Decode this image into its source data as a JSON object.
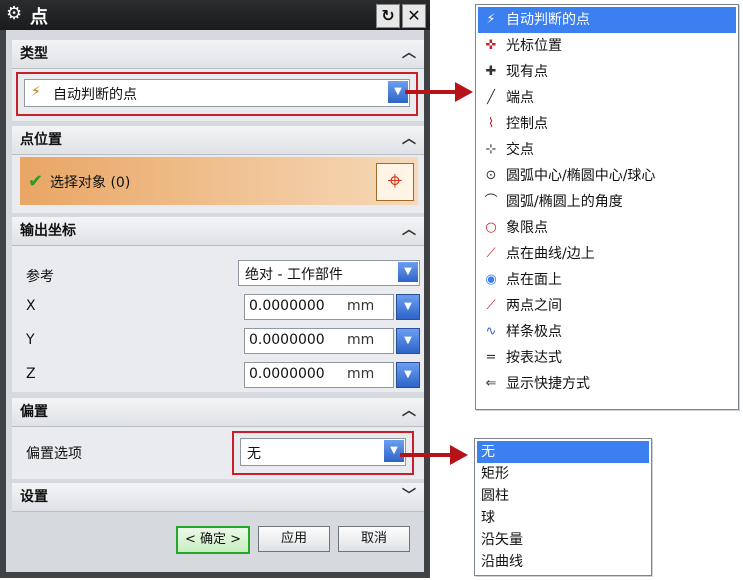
{
  "dialog": {
    "title": "点",
    "icons": {
      "settings": "gear-icon",
      "reset": "reset-icon",
      "close": "close-icon"
    },
    "reset_glyph": "↻",
    "close_glyph": "✕",
    "sections": {
      "type": {
        "label": "类型",
        "value": "自动判断的点"
      },
      "point_location": {
        "label": "点位置",
        "select_label": "选择对象 (0)"
      },
      "output": {
        "label": "输出坐标",
        "reference_label": "参考",
        "reference_value": "绝对 - 工作部件",
        "x_label": "X",
        "x_value": "0.0000000",
        "x_unit": "mm",
        "y_label": "Y",
        "y_value": "0.0000000",
        "y_unit": "mm",
        "z_label": "Z",
        "z_value": "0.0000000",
        "z_unit": "mm"
      },
      "offset": {
        "label": "偏置",
        "option_label": "偏置选项",
        "option_value": "无"
      },
      "settings": {
        "label": "设置"
      }
    },
    "buttons": {
      "ok": "< 确定 >",
      "apply": "应用",
      "cancel": "取消"
    }
  },
  "type_menu": {
    "items": [
      {
        "label": "自动判断的点",
        "icon": "inferred-point-icon",
        "selected": true
      },
      {
        "label": "光标位置",
        "icon": "cursor-location-icon"
      },
      {
        "label": "现有点",
        "icon": "existing-point-icon"
      },
      {
        "label": "端点",
        "icon": "end-point-icon"
      },
      {
        "label": "控制点",
        "icon": "control-point-icon"
      },
      {
        "label": "交点",
        "icon": "intersection-point-icon"
      },
      {
        "label": "圆弧中心/椭圆中心/球心",
        "icon": "arc-center-icon"
      },
      {
        "label": "圆弧/椭圆上的角度",
        "icon": "angle-on-arc-icon"
      },
      {
        "label": "象限点",
        "icon": "quadrant-point-icon"
      },
      {
        "label": "点在曲线/边上",
        "icon": "point-on-curve-icon"
      },
      {
        "label": "点在面上",
        "icon": "point-on-face-icon"
      },
      {
        "label": "两点之间",
        "icon": "between-points-icon"
      },
      {
        "label": "样条极点",
        "icon": "spline-pole-icon"
      },
      {
        "label": "按表达式",
        "icon": "expression-icon"
      },
      {
        "label": "显示快捷方式",
        "icon": "shortcut-icon"
      }
    ]
  },
  "offset_menu": {
    "items": [
      {
        "label": "无",
        "selected": true
      },
      {
        "label": "矩形"
      },
      {
        "label": "圆柱"
      },
      {
        "label": "球"
      },
      {
        "label": "沿矢量"
      },
      {
        "label": "沿曲线"
      }
    ]
  },
  "colors": {
    "highlight": "#3b7ff0",
    "annotation_red": "#c8202a",
    "select_bar": "#e9a664"
  }
}
